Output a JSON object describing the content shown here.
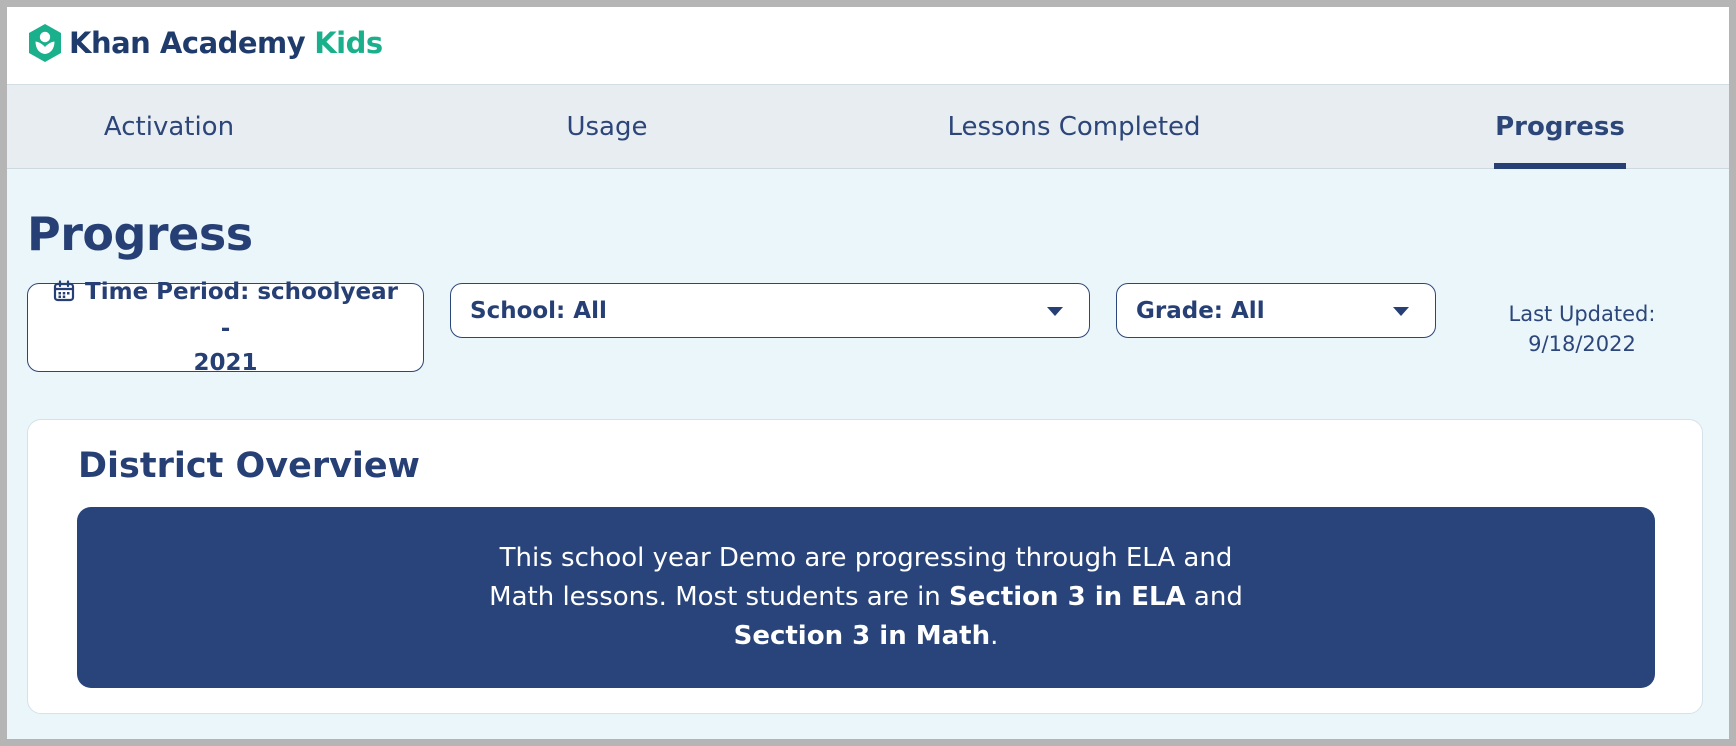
{
  "logo": {
    "brand": "Khan Academy",
    "suffix": "Kids",
    "icon": "khan-academy-kids-logo-icon",
    "brand_color": "#1f3b6c",
    "accent_color": "#19b08b"
  },
  "tabs": [
    {
      "label": "Activation",
      "active": false
    },
    {
      "label": "Usage",
      "active": false
    },
    {
      "label": "Lessons Completed",
      "active": false
    },
    {
      "label": "Progress",
      "active": true
    }
  ],
  "page": {
    "title": "Progress"
  },
  "filters": {
    "time_period_line1": "Time Period: schoolyear -",
    "time_period_line2": "2021",
    "time_icon": "calendar-icon",
    "school": "School: All",
    "grade": "Grade: All",
    "dropdown_icon": "caret-down-icon"
  },
  "last_updated": {
    "label": "Last Updated:",
    "date": "9/18/2022"
  },
  "overview": {
    "title": "District Overview",
    "text_part1": "This school year Demo are progressing through ELA and Math lessons. Most students are in ",
    "highlight1": "Section 3 in ELA",
    "text_part2": " and ",
    "highlight2": "Section 3 in Math",
    "text_part3": "."
  },
  "colors": {
    "navy": "#263f75",
    "banner": "#29447a",
    "page_bg": "#eaf6fa",
    "tab_bg": "#e8edf1"
  }
}
